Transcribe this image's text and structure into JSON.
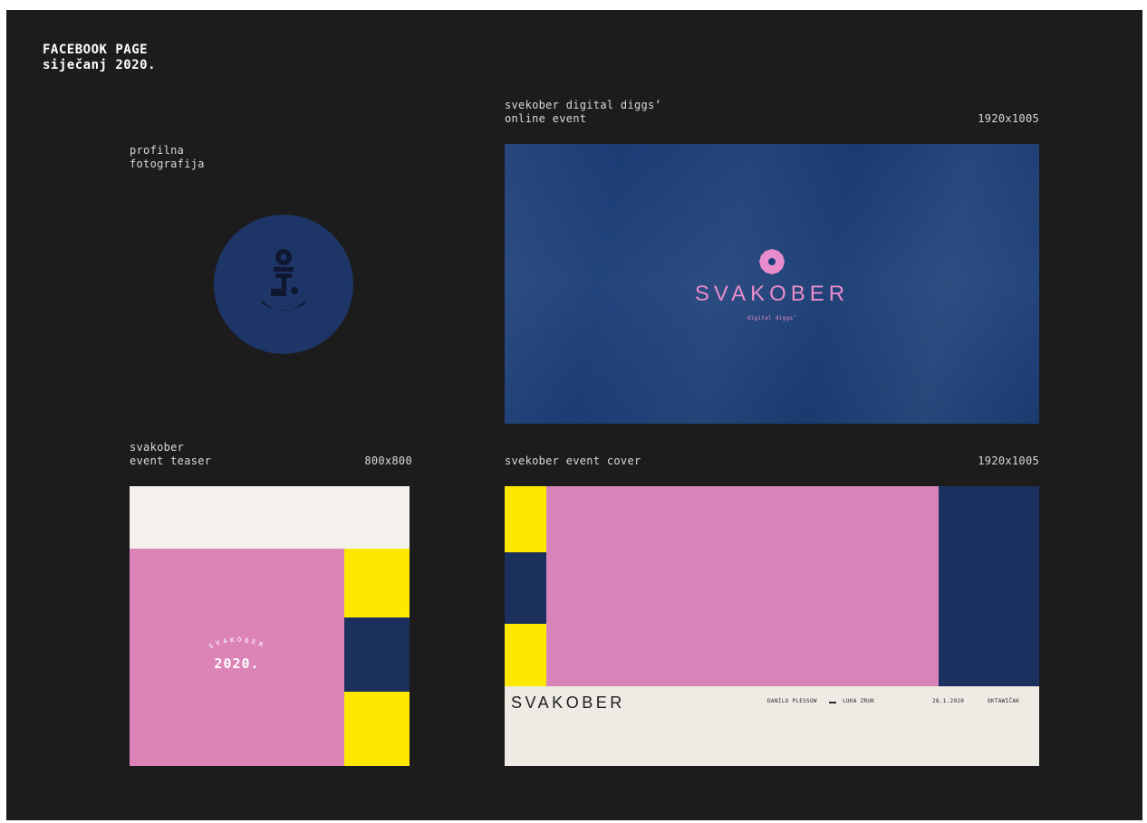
{
  "page": {
    "title_line1": "FACEBOOK PAGE",
    "title_line2": "siječanj 2020."
  },
  "profile": {
    "label_line1": "profilna",
    "label_line2": "fotografija",
    "icon": "flower-sprout-icon"
  },
  "online_event": {
    "label_line1": "svekober digital diggs’",
    "label_line2": "online event",
    "size": "1920x1005",
    "brand": "SVAKOBER",
    "tagline": "digital diggs’",
    "icon": "pink-flower-icon"
  },
  "teaser": {
    "label_line1": "svakober",
    "label_line2": "event teaser",
    "size": "800x800",
    "arc_text": "SVAKOBER",
    "year": "2020."
  },
  "cover": {
    "label": "svekober event cover",
    "size": "1920x1005",
    "brand": "SVAKOBER",
    "artist1": "DANILO PLESSOW",
    "artist2": "LUKA ZRUK",
    "date": "28.1.2020",
    "venue": "OKTAWIČAK"
  },
  "colors": {
    "background": "#1c1c1c",
    "navy": "#1c3f78",
    "pink": "#dc84b7",
    "yellow": "#ffe800",
    "cream": "#f4f1ec"
  }
}
